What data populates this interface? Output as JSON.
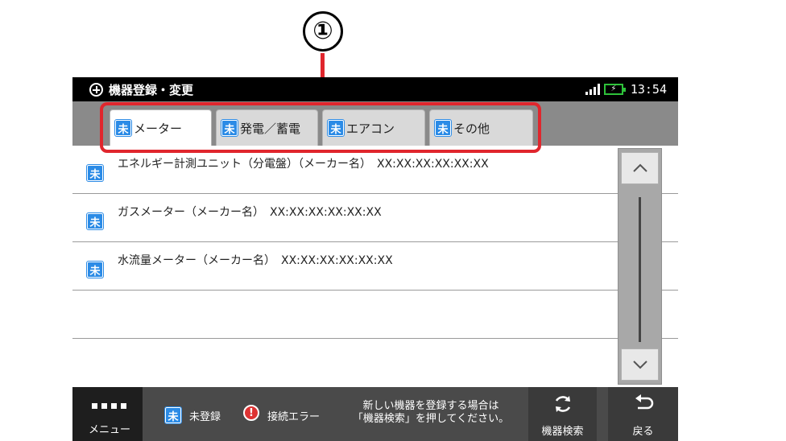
{
  "annotation": {
    "marker": "①"
  },
  "titlebar": {
    "title": "機器登録・変更",
    "clock": "13:54"
  },
  "tabs": [
    {
      "badge": "未",
      "label": "メーター",
      "active": true
    },
    {
      "badge": "未",
      "label": "発電／蓄電",
      "active": false
    },
    {
      "badge": "未",
      "label": "エアコン",
      "active": false
    },
    {
      "badge": "未",
      "label": "その他",
      "active": false
    }
  ],
  "devices": [
    {
      "badge": "未",
      "label": "エネルギー計測ユニット（分電盤）（メーカー名）　XX:XX:XX:XX:XX:XX"
    },
    {
      "badge": "未",
      "label": "ガスメーター（メーカー名）　XX:XX:XX:XX:XX:XX"
    },
    {
      "badge": "未",
      "label": "水流量メーター（メーカー名）　XX:XX:XX:XX:XX:XX"
    }
  ],
  "bottombar": {
    "menu_label": "メニュー",
    "legend_unregistered_badge": "未",
    "legend_unregistered": "未登録",
    "legend_error_icon": "!",
    "legend_error": "接続エラー",
    "hint_line1": "新しい機器を登録する場合は",
    "hint_line2": "「機器検索」を押してください。",
    "search_label": "機器検索",
    "back_label": "戻る"
  },
  "colors": {
    "accent_red": "#e0262d",
    "badge_blue": "#2b8be6",
    "battery_green": "#2ec23a"
  },
  "icons": {
    "title": "plus-circle-icon",
    "signal": "signal-icon",
    "battery": "battery-charging-icon",
    "menu": "menu-dots-icon",
    "search": "refresh-icon",
    "back": "return-arrow-icon",
    "scroll_up": "chevron-up-icon",
    "scroll_down": "chevron-down-icon"
  }
}
